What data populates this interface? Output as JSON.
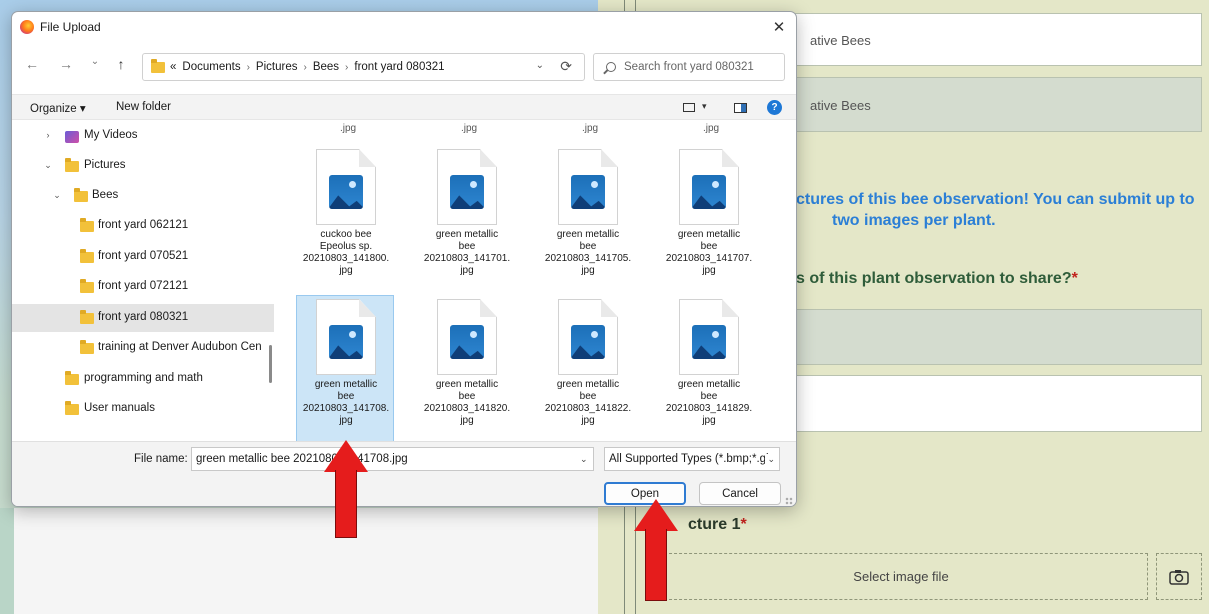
{
  "background_page": {
    "field1_text": "ative Bees",
    "field2_text": "ative Bees",
    "blue_heading_line1": "ctures of this bee observation! You can submit up to",
    "blue_heading_line2": "two images per plant.",
    "green_question": "s of this plant observation to share?",
    "required_mark": "*",
    "picture_label": "cture 1",
    "dropzone_text": "Select image file",
    "camera_icon": "camera-icon"
  },
  "dialog": {
    "title": "File Upload",
    "close_glyph": "✕",
    "nav_back": "←",
    "nav_forward": "→",
    "nav_recent": "⌄",
    "nav_up": "↑",
    "address": {
      "prefix": "«",
      "segments": [
        "Documents",
        "Pictures",
        "Bees",
        "front yard 080321"
      ],
      "separator": "›"
    },
    "search_placeholder": "Search front yard 080321",
    "toolbar": {
      "organize": "Organize ▾",
      "new_folder": "New folder"
    },
    "nav_items": [
      {
        "label": "My Videos",
        "chevron": "›",
        "icon": "video"
      },
      {
        "label": "Pictures",
        "chevron": "⌄",
        "icon": "folder"
      },
      {
        "label": "Bees",
        "chevron": "⌄",
        "icon": "folder"
      },
      {
        "label": "front yard 062121",
        "chevron": "",
        "icon": "folder"
      },
      {
        "label": "front yard 070521",
        "chevron": "",
        "icon": "folder"
      },
      {
        "label": "front yard 072121",
        "chevron": "",
        "icon": "folder"
      },
      {
        "label": "front yard 080321",
        "chevron": "",
        "icon": "folder",
        "selected": true
      },
      {
        "label": "training at Denver Audubon Cen",
        "chevron": "",
        "icon": "folder"
      },
      {
        "label": "programming and math",
        "chevron": "",
        "icon": "folder"
      },
      {
        "label": "User manuals",
        "chevron": "",
        "icon": "folder"
      }
    ],
    "top_fragment": ".jpg",
    "files": [
      {
        "lines": [
          "cuckoo bee",
          "Epeolus sp.",
          "20210803_141800.",
          "jpg"
        ]
      },
      {
        "lines": [
          "green metallic",
          "bee",
          "20210803_141701.",
          "jpg"
        ]
      },
      {
        "lines": [
          "green metallic",
          "bee",
          "20210803_141705.",
          "jpg"
        ]
      },
      {
        "lines": [
          "green metallic",
          "bee",
          "20210803_141707.",
          "jpg"
        ]
      },
      {
        "lines": [
          "green metallic",
          "bee",
          "20210803_141708.",
          "jpg"
        ],
        "selected": true
      },
      {
        "lines": [
          "green metallic",
          "bee",
          "20210803_141820.",
          "jpg"
        ]
      },
      {
        "lines": [
          "green metallic",
          "bee",
          "20210803_141822.",
          "jpg"
        ]
      },
      {
        "lines": [
          "green metallic",
          "bee",
          "20210803_141829.",
          "jpg"
        ]
      }
    ],
    "filename_label": "File name:",
    "filename_value": "green metallic bee 20210803_141708.jpg",
    "filetype_value": "All Supported Types (*.bmp;*.gi",
    "open_label": "Open",
    "cancel_label": "Cancel"
  },
  "colors": {
    "accent_blue": "#2f7bd2",
    "arrow_red": "#e51c1c",
    "selection_blue": "#cce5f7"
  }
}
